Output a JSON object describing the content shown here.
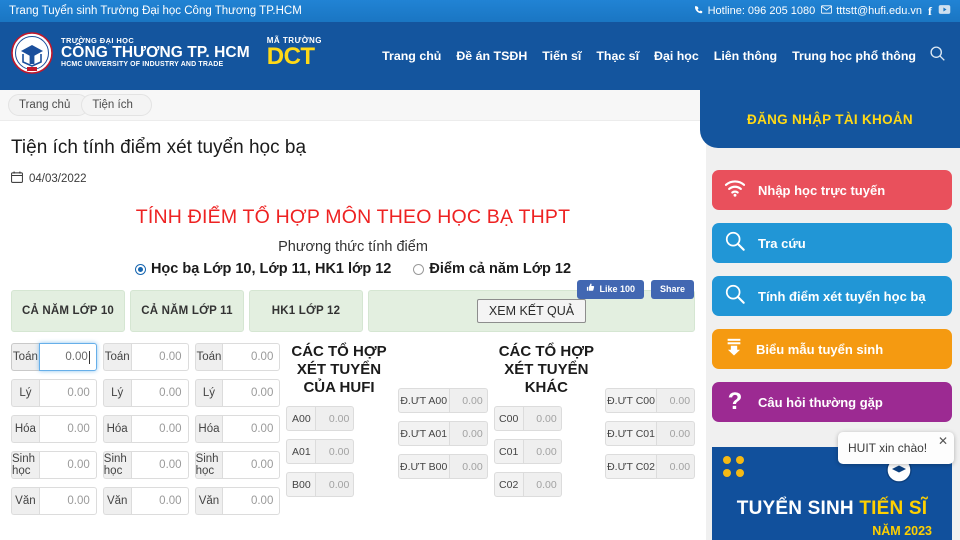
{
  "topbar": {
    "title": "Trang Tuyển sinh Trường Đại học Công Thương TP.HCM",
    "hotline_label": "Hotline: 096 205 1080",
    "email": "tttstt@hufi.edu.vn",
    "phone_icon": "phone-icon",
    "mail_icon": "mail-icon",
    "facebook_icon": "facebook-icon",
    "youtube_icon": "youtube-icon"
  },
  "header": {
    "logo": {
      "line1": "TRƯỜNG ĐẠI HỌC",
      "line2": "CÔNG THƯƠNG TP. HCM",
      "line3": "HCMC UNIVERSITY OF INDUSTRY AND TRADE",
      "seal_icon": "university-seal-icon"
    },
    "school_code": {
      "label": "MÃ TRƯỜNG",
      "code": "DCT"
    },
    "nav": [
      {
        "label": "Trang chủ"
      },
      {
        "label": "Đề án TSĐH"
      },
      {
        "label": "Tiến sĩ"
      },
      {
        "label": "Thạc sĩ"
      },
      {
        "label": "Đại học"
      },
      {
        "label": "Liên thông"
      },
      {
        "label": "Trung học phổ thông"
      }
    ],
    "search_icon": "search-icon"
  },
  "breadcrumb": [
    {
      "label": "Trang chủ"
    },
    {
      "label": "Tiện ích"
    }
  ],
  "page": {
    "title": "Tiện ích tính điểm xét tuyển học bạ",
    "date": "04/03/2022",
    "calendar_icon": "calendar-icon"
  },
  "social": {
    "like_label": "Like 100",
    "share_label": "Share",
    "thumb_icon": "thumbs-up-icon"
  },
  "calculator": {
    "title": "TÍNH ĐIỂM TỔ HỢP MÔN THEO HỌC BẠ THPT",
    "method_label": "Phương thức tính điểm",
    "options": [
      {
        "label": "Học bạ Lớp 10, Lớp 11, HK1 lớp 12",
        "selected": true
      },
      {
        "label": "Điểm cả năm Lớp 12",
        "selected": false
      }
    ],
    "tabs": [
      {
        "label": "CẢ NĂM LỚP 10"
      },
      {
        "label": "CẢ NĂM LỚP 11"
      },
      {
        "label": "HK1 LỚP 12"
      }
    ],
    "result_button": "XEM KẾT QUẢ",
    "subjects": [
      "Toán",
      "Lý",
      "Hóa",
      "Sinh học",
      "Văn"
    ],
    "columns": [
      {
        "values": [
          "0.00",
          "0.00",
          "0.00",
          "0.00",
          "0.00"
        ],
        "focused_index": 0
      },
      {
        "values": [
          "0.00",
          "0.00",
          "0.00",
          "0.00",
          "0.00"
        ],
        "focused_index": -1
      },
      {
        "values": [
          "0.00",
          "0.00",
          "0.00",
          "0.00",
          "0.00"
        ],
        "focused_index": -1
      }
    ],
    "combo_hufi": {
      "heading": "CÁC TỔ HỢP XÉT TUYỂN CỦA HUFI",
      "rows": [
        {
          "code": "A00",
          "score": "0.00",
          "pref_code": "Đ.ƯT A00",
          "pref_score": "0.00"
        },
        {
          "code": "A01",
          "score": "0.00",
          "pref_code": "Đ.ƯT A01",
          "pref_score": "0.00"
        },
        {
          "code": "B00",
          "score": "0.00",
          "pref_code": "Đ.ƯT B00",
          "pref_score": "0.00"
        }
      ]
    },
    "combo_other": {
      "heading": "CÁC TỔ HỢP XÉT TUYỂN KHÁC",
      "rows": [
        {
          "code": "C00",
          "score": "0.00",
          "pref_code": "Đ.ƯT C00",
          "pref_score": "0.00"
        },
        {
          "code": "C01",
          "score": "0.00",
          "pref_code": "Đ.ƯT C01",
          "pref_score": "0.00"
        },
        {
          "code": "C02",
          "score": "0.00",
          "pref_code": "Đ.ƯT C02",
          "pref_score": "0.00"
        }
      ]
    }
  },
  "sidebar": {
    "login_label": "ĐĂNG NHẬP TÀI KHOẢN",
    "buttons": [
      {
        "label": "Nhập học trực tuyến",
        "color": "#e9505c",
        "icon": "wifi-icon"
      },
      {
        "label": "Tra cứu",
        "color": "#2196d6",
        "icon": "magnifier-icon"
      },
      {
        "label": "Tính điểm xét tuyển học bạ",
        "color": "#2196d6",
        "icon": "magnifier-icon"
      },
      {
        "label": "Biểu mẫu tuyển sinh",
        "color": "#f59a11",
        "icon": "download-icon"
      },
      {
        "label": "Câu hỏi thường gặp",
        "color": "#9c2a92",
        "icon": "question-icon"
      }
    ]
  },
  "banner": {
    "line1_a": "TUYỂN SINH ",
    "line1_b": "TIẾN SĨ",
    "line2": "NĂM 2023",
    "seal_icon": "university-seal-icon"
  },
  "chat": {
    "message": "HUIT xin chào!",
    "close_icon": "close-icon"
  },
  "colors": {
    "topbar": "#1a76c3",
    "header": "#14559e",
    "accent_yellow": "#ffd917",
    "calc_title_red": "#ee2222",
    "panel_green": "#e3efe0",
    "focus_blue": "#66afe9"
  }
}
